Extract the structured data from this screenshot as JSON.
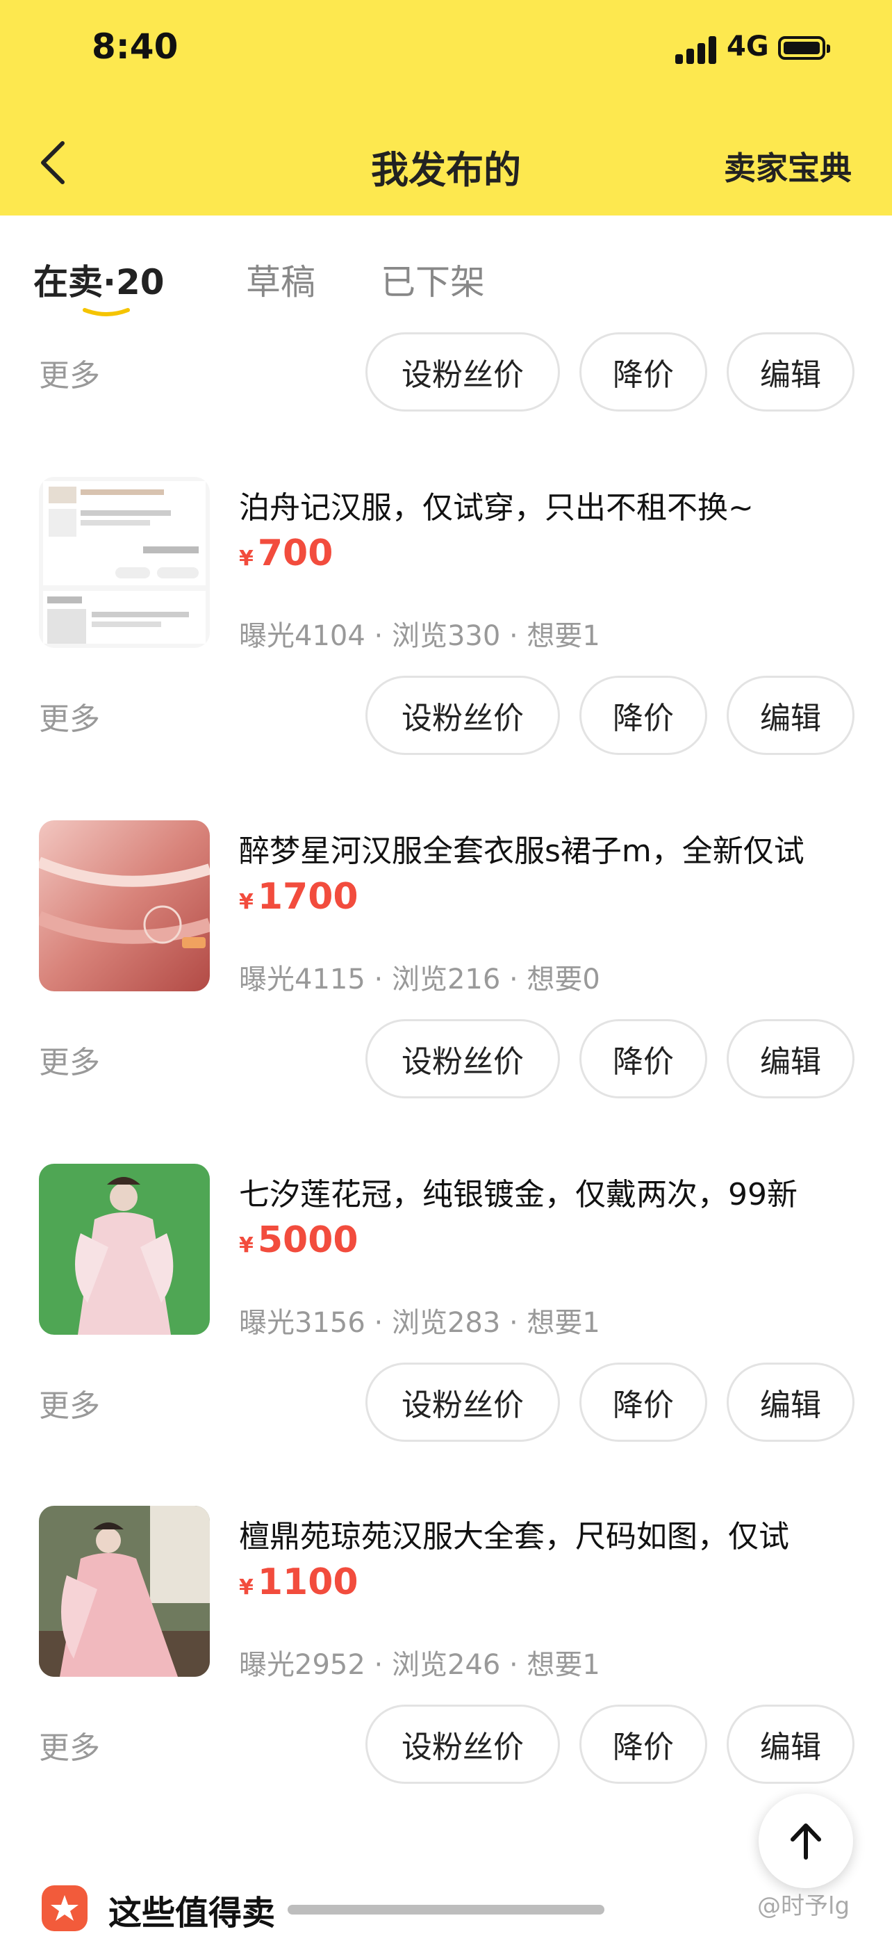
{
  "status_bar": {
    "time": "8:40",
    "network": "4G"
  },
  "nav": {
    "title": "我发布的",
    "right_link": "卖家宝典"
  },
  "tabs": [
    {
      "label": "在卖·20"
    },
    {
      "label": "草稿"
    },
    {
      "label": "已下架"
    }
  ],
  "actions": {
    "more": "更多",
    "fans_price": "设粉丝价",
    "reduce_price": "降价",
    "edit": "编辑"
  },
  "currency_symbol": "¥",
  "items": [
    {
      "title": "泊舟记汉服，仅试穿，只出不租不换~",
      "price": "700",
      "stats": "曝光4104 · 浏览330 · 想要1"
    },
    {
      "title": "醉梦星河汉服全套衣服s裙子m，全新仅试",
      "price": "1700",
      "stats": "曝光4115 · 浏览216 · 想要0"
    },
    {
      "title": "七汐莲花冠，纯银镀金，仅戴两次，99新",
      "price": "5000",
      "stats": "曝光3156 · 浏览283 · 想要1"
    },
    {
      "title": "檀鼎苑琼苑汉服大全套，尺码如图，仅试",
      "price": "1100",
      "stats": "曝光2952 · 浏览246 · 想要1"
    }
  ],
  "bottom": {
    "worth_selling": "这些值得卖",
    "watermark": "@时予lg"
  },
  "colors": {
    "header_bg": "#fde84f",
    "price": "#f24c3d"
  }
}
